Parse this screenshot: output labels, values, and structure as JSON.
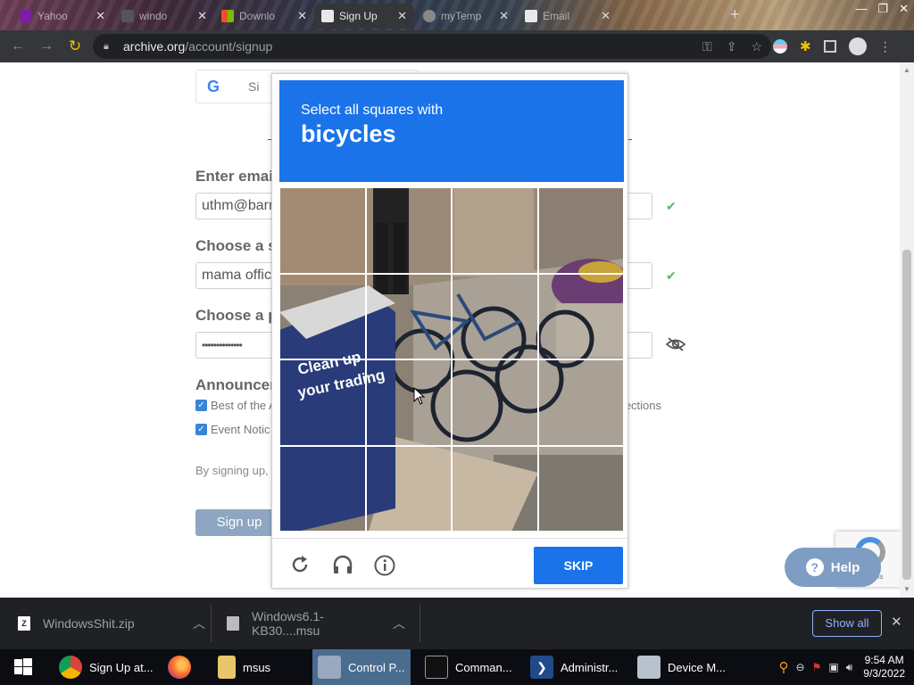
{
  "browser": {
    "tabs": [
      {
        "title": "Yahoo",
        "active": false
      },
      {
        "title": "windo",
        "active": false
      },
      {
        "title": "Downlo",
        "active": false
      },
      {
        "title": "Sign Up",
        "active": true
      },
      {
        "title": "myTemp",
        "active": false
      },
      {
        "title": "Email",
        "active": false
      }
    ],
    "url_domain": "archive.org",
    "url_path": "/account/signup"
  },
  "signup_form": {
    "google_button_label": "Si",
    "email_label": "Enter email",
    "email_value": "uthm@barr",
    "screenname_label": "Choose a s",
    "screenname_value": "mama offic",
    "password_label": "Choose a p",
    "password_value": "••••••••••••••",
    "announcements_label": "Announcem",
    "checkbox_1_label": "Best of the A",
    "checkbox_1_right": "llections",
    "checkbox_2_label": "Event Notic",
    "terms_text": "By signing up,",
    "signup_button": "Sign up",
    "recaptcha_terms": "rms"
  },
  "captcha": {
    "instruction": "Select all squares with",
    "target": "bicycles",
    "skip_label": "SKIP"
  },
  "help_button": "Help",
  "downloads": {
    "items": [
      "WindowsShit.zip",
      "Windows6.1-KB30....msu"
    ],
    "show_all": "Show all"
  },
  "taskbar": {
    "items": [
      {
        "label": "Sign Up at..."
      },
      {
        "label": ""
      },
      {
        "label": "msus"
      },
      {
        "label": "Control P..."
      },
      {
        "label": "Comman..."
      },
      {
        "label": "Administr..."
      },
      {
        "label": "Device M..."
      }
    ],
    "time": "9:54 AM",
    "date": "9/3/2022"
  },
  "colors": {
    "accent": "#1a73e8",
    "signup_button": "#8ea6c1",
    "checkbox": "#3b84d8",
    "chrome_dark": "#35363a"
  }
}
